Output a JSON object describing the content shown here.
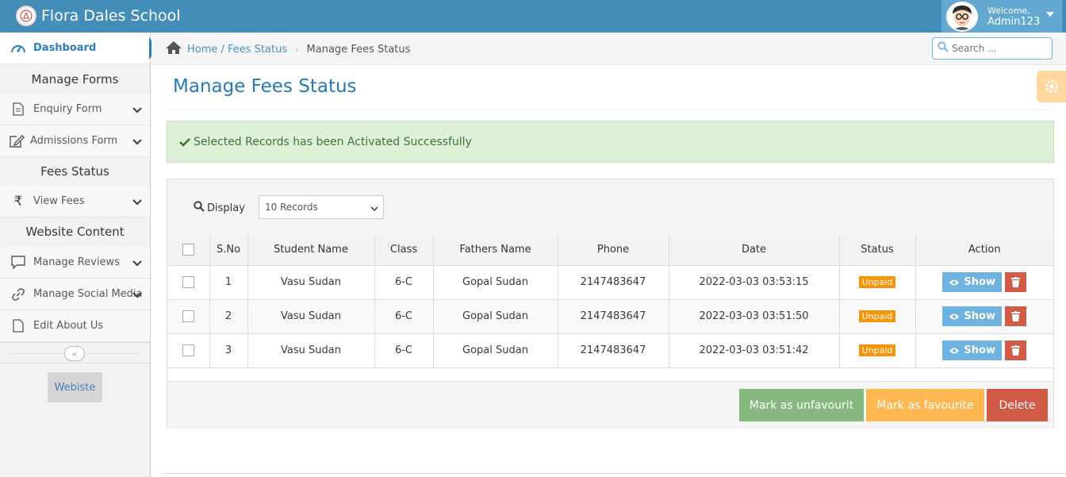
{
  "app": {
    "title": "Flora Dales School"
  },
  "user": {
    "welcome": "Welcome,",
    "name": "Admin123"
  },
  "sidebar": {
    "dashboard": "Dashboard",
    "sections": [
      {
        "header": "Manage Forms"
      },
      {
        "header": "Fees Status"
      },
      {
        "header": "Website Content"
      }
    ],
    "items": [
      {
        "label": "Enquiry Form",
        "icon": "file-icon"
      },
      {
        "label": "Admissions Form",
        "icon": "edit-icon"
      },
      {
        "label": "View Fees",
        "icon": "rupee-icon"
      },
      {
        "label": "Manage Reviews",
        "icon": "comment-icon"
      },
      {
        "label": "Manage Social Media",
        "icon": "link-icon"
      },
      {
        "label": "Edit About Us",
        "icon": "file-icon"
      }
    ],
    "website_button": "Webiste"
  },
  "breadcrumb": {
    "home": "Home / Fees Status",
    "current": "Manage Fees Status"
  },
  "search": {
    "placeholder": "Search ..."
  },
  "page": {
    "title": "Manage Fees Status"
  },
  "alert": {
    "message": "Selected Records has been Activated Successfully"
  },
  "toolbar": {
    "display_label": "Display",
    "records_option": "10 Records"
  },
  "table": {
    "headers": [
      "S.No",
      "Student Name",
      "Class",
      "Fathers Name",
      "Phone",
      "Date",
      "Status",
      "Action"
    ],
    "rows": [
      {
        "sno": "1",
        "student": "Vasu Sudan",
        "class": "6-C",
        "father": "Gopal Sudan",
        "phone": "2147483647",
        "date": "2022-03-03 03:53:15",
        "status": "Unpaid"
      },
      {
        "sno": "2",
        "student": "Vasu Sudan",
        "class": "6-C",
        "father": "Gopal Sudan",
        "phone": "2147483647",
        "date": "2022-03-03 03:51:50",
        "status": "Unpaid"
      },
      {
        "sno": "3",
        "student": "Vasu Sudan",
        "class": "6-C",
        "father": "Gopal Sudan",
        "phone": "2147483647",
        "date": "2022-03-03 03:51:42",
        "status": "Unpaid"
      }
    ],
    "show_label": "Show"
  },
  "actions": {
    "unfavourite": "Mark as unfavourit",
    "favourite": "Mark as favourite",
    "delete": "Delete"
  },
  "colors": {
    "navbar": "#438eb9",
    "success_bg": "#dff0d8",
    "warning": "#f89406",
    "danger": "#d15b47",
    "info": "#6fb3e0",
    "green": "#87b87f",
    "yellow": "#ffb752"
  }
}
